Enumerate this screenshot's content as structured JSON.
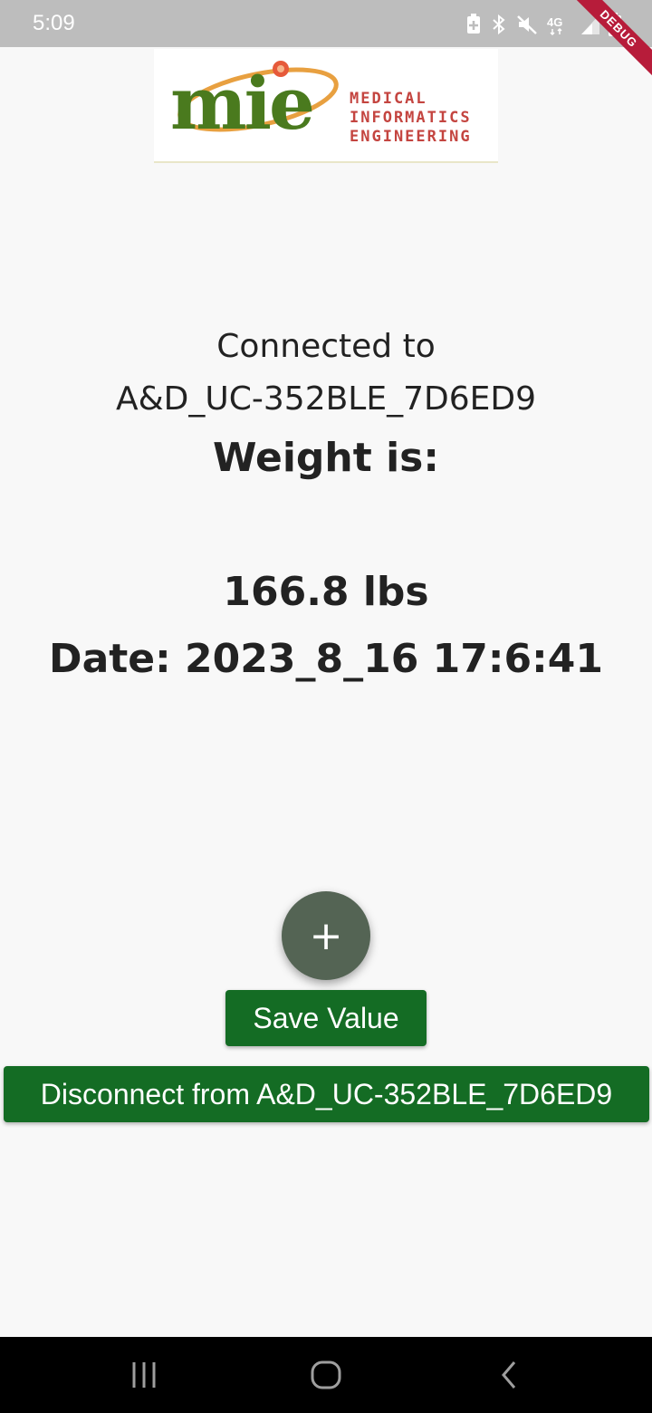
{
  "status_bar": {
    "time": "5:09",
    "icons": [
      "battery-saver-icon",
      "bluetooth-icon",
      "mute-icon",
      "network-4g-icon",
      "signal-icon",
      "battery-icon"
    ],
    "debug_label": "DEBUG"
  },
  "logo": {
    "word": "mie",
    "lines": [
      "MEDICAL",
      "INFORMATICS",
      "ENGINEERING"
    ]
  },
  "main": {
    "connected_label": "Connected to",
    "device_name": "A&D_UC-352BLE_7D6ED9",
    "weight_heading": "Weight is:",
    "weight_value": "166.8 lbs",
    "date_line": "Date: 2023_8_16 17:6:41"
  },
  "actions": {
    "fab_label": "+",
    "save_label": "Save Value",
    "disconnect_label": "Disconnect from A&D_UC-352BLE_7D6ED9"
  },
  "nav_bar": {
    "items": [
      "recent-apps-icon",
      "home-icon",
      "back-icon"
    ]
  },
  "colors": {
    "status_bar": "#bdbdbd",
    "background": "#f8f8f8",
    "button_green": "#146c24",
    "fab": "#546454",
    "logo_green": "#4a7a1e",
    "logo_red": "#c44540",
    "debug_ribbon": "#b71c3a"
  }
}
